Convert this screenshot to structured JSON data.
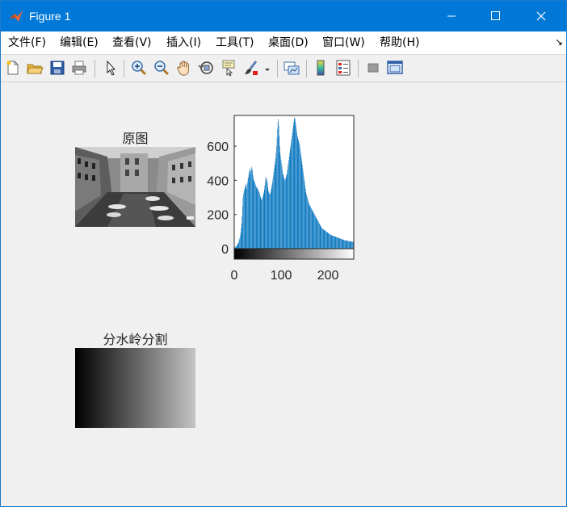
{
  "window": {
    "title": "Figure 1"
  },
  "menu": [
    {
      "label": "文件(F)"
    },
    {
      "label": "编辑(E)"
    },
    {
      "label": "查看(V)"
    },
    {
      "label": "插入(I)"
    },
    {
      "label": "工具(T)"
    },
    {
      "label": "桌面(D)"
    },
    {
      "label": "窗口(W)"
    },
    {
      "label": "帮助(H)"
    }
  ],
  "toolbar": {
    "icons": [
      "new-figure-icon",
      "open-file-icon",
      "save-icon",
      "print-icon",
      "pointer-icon",
      "zoom-in-icon",
      "zoom-out-icon",
      "pan-hand-icon",
      "rotate-3d-icon",
      "data-cursor-icon",
      "brush-icon",
      "link-plot-icon",
      "colorbar-icon",
      "legend-icon",
      "hide-plot-tools-icon",
      "show-plot-tools-icon"
    ]
  },
  "axes": {
    "original_title": "原图",
    "watershed_title": "分水岭分割"
  },
  "chart_data": {
    "type": "bar",
    "title": "",
    "xlabel": "",
    "ylabel": "",
    "xlim": [
      0,
      255
    ],
    "ylim": [
      0,
      780
    ],
    "xticks": [
      0,
      100,
      200
    ],
    "yticks": [
      0,
      200,
      400,
      600
    ],
    "bar_color": "#0072bd",
    "grid": false,
    "x_colorbar": "gray",
    "values": [
      4,
      7,
      8,
      12,
      15,
      18,
      22,
      26,
      30,
      36,
      45,
      55,
      65,
      78,
      95,
      120,
      148,
      190,
      250,
      300,
      320,
      335,
      345,
      355,
      370,
      380,
      365,
      350,
      375,
      390,
      410,
      420,
      440,
      455,
      470,
      455,
      440,
      465,
      480,
      470,
      455,
      430,
      410,
      400,
      395,
      390,
      380,
      370,
      365,
      355,
      350,
      360,
      345,
      340,
      335,
      330,
      320,
      310,
      300,
      290,
      285,
      290,
      300,
      310,
      320,
      330,
      345,
      370,
      390,
      410,
      420,
      410,
      400,
      385,
      360,
      340,
      330,
      320,
      318,
      322,
      330,
      345,
      360,
      375,
      390,
      410,
      430,
      450,
      470,
      490,
      510,
      530,
      560,
      600,
      650,
      700,
      740,
      760,
      720,
      660,
      600,
      560,
      540,
      520,
      500,
      480,
      460,
      440,
      430,
      420,
      410,
      405,
      400,
      410,
      420,
      430,
      440,
      460,
      480,
      500,
      520,
      540,
      560,
      580,
      600,
      620,
      640,
      660,
      680,
      700,
      720,
      740,
      760,
      770,
      760,
      740,
      720,
      700,
      680,
      660,
      650,
      640,
      630,
      620,
      610,
      590,
      570,
      550,
      530,
      510,
      490,
      470,
      450,
      430,
      410,
      390,
      370,
      350,
      330,
      320,
      310,
      300,
      290,
      280,
      270,
      260,
      255,
      250,
      245,
      240,
      235,
      230,
      225,
      220,
      215,
      210,
      205,
      200,
      195,
      190,
      185,
      180,
      175,
      170,
      165,
      160,
      155,
      150,
      145,
      140,
      135,
      130,
      125,
      120,
      118,
      116,
      114,
      112,
      110,
      108,
      106,
      104,
      102,
      100,
      98,
      96,
      94,
      92,
      90,
      88,
      86,
      84,
      82,
      80,
      79,
      78,
      77,
      76,
      75,
      74,
      73,
      72,
      71,
      70,
      69,
      68,
      67,
      66,
      65,
      64,
      63,
      62,
      61,
      60,
      59,
      58,
      57,
      56,
      55,
      54,
      53,
      52,
      51,
      50,
      49,
      48,
      48,
      47,
      47,
      46,
      46,
      45,
      45,
      44,
      44,
      43,
      43,
      42,
      42,
      41,
      41,
      40,
      40,
      40
    ]
  }
}
